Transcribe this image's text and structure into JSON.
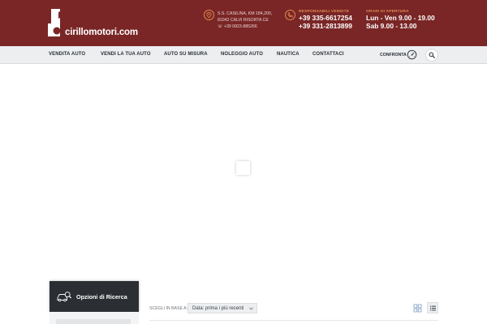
{
  "header": {
    "logo_text": "cirillomotori.com",
    "address": {
      "line1": "S.S. CASILINA, KM 184,200,",
      "line2": "81042 CALVI RISORTA CE",
      "phone": "+39 0823-885266"
    },
    "sales": {
      "label": "RESPONSABILI VENDITE",
      "phone1": "+39 335-6617254",
      "phone2": "+39 331-2813899"
    },
    "hours": {
      "label": "ORARI DI APERTURA",
      "weekdays": "Lun - Ven 9.00 - 19.00",
      "saturday": "Sab 9.00 - 13.00"
    }
  },
  "nav": {
    "items": [
      {
        "label": "VENDITA AUTO"
      },
      {
        "label": "VENDI LA TUA AUTO"
      },
      {
        "label": "AUTO SU MISURA"
      },
      {
        "label": "NOLEGGIO AUTO"
      },
      {
        "label": "NAUTICA"
      },
      {
        "label": "CONTATTACI"
      }
    ],
    "compare_label": "CONFRONTA"
  },
  "search_panel": {
    "title": "Opzioni di Ricerca"
  },
  "sort": {
    "label": "SCEGLI IN BASE A:",
    "selected": "Data: prima i più recenti"
  },
  "colors": {
    "header_bg": "#7a2626",
    "accent": "#e08a50",
    "nav_bg": "#eceef0",
    "panel_bg": "#2b2f33"
  },
  "icons": {
    "location": "map-pin-icon",
    "sales": "phone-icon",
    "compare": "speedometer-icon",
    "search": "search-icon",
    "options": "car-search-icon",
    "grid_view": "grid-icon",
    "list_view": "list-icon"
  }
}
